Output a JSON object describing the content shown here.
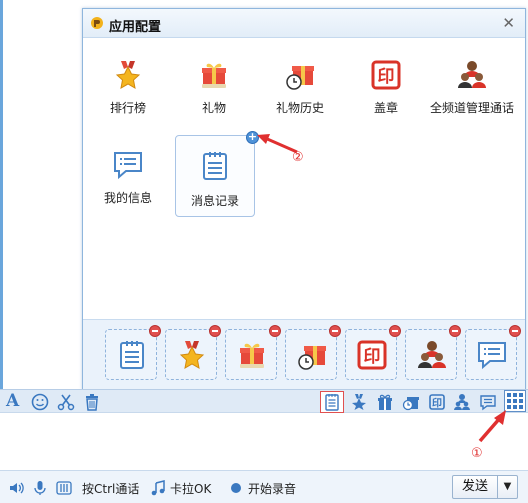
{
  "popup": {
    "title": "应用配置",
    "close_glyph": "✕"
  },
  "apps": [
    {
      "label": "排行榜",
      "icon": "ranking-medal-icon"
    },
    {
      "label": "礼物",
      "icon": "gift-icon"
    },
    {
      "label": "礼物历史",
      "icon": "gift-history-icon"
    },
    {
      "label": "盖章",
      "icon": "stamp-icon"
    },
    {
      "label": "全频道管理通话",
      "icon": "channel-admin-icon"
    },
    {
      "label": "我的信息",
      "icon": "my-info-icon"
    },
    {
      "label": "消息记录",
      "icon": "message-record-icon"
    }
  ],
  "plus_glyph": "+",
  "dock_slots": [
    "message-record-icon",
    "ranking-medal-icon",
    "gift-icon",
    "gift-history-icon",
    "stamp-icon",
    "channel-admin-icon",
    "my-info-icon"
  ],
  "toolbar": {
    "font_glyph": "A",
    "icons_left": [
      "font-icon",
      "emoji-icon",
      "scissors-icon",
      "trash-icon"
    ],
    "icons_right": [
      "message-record-icon",
      "ranking-icon",
      "gift-icon",
      "gift-history-icon",
      "stamp-icon",
      "channel-admin-icon",
      "my-info-icon",
      "app-grid-icon"
    ]
  },
  "bottombar": {
    "ctrl_talk": "按Ctrl通话",
    "karaoke": "卡拉OK",
    "record": "开始录音",
    "send": "发送",
    "send_dropdown": "▼"
  },
  "annotations": {
    "one": "①",
    "two": "②"
  },
  "colors": {
    "accent": "#4f93d8",
    "remove_badge": "#e0504f",
    "annotation": "#e03030"
  }
}
